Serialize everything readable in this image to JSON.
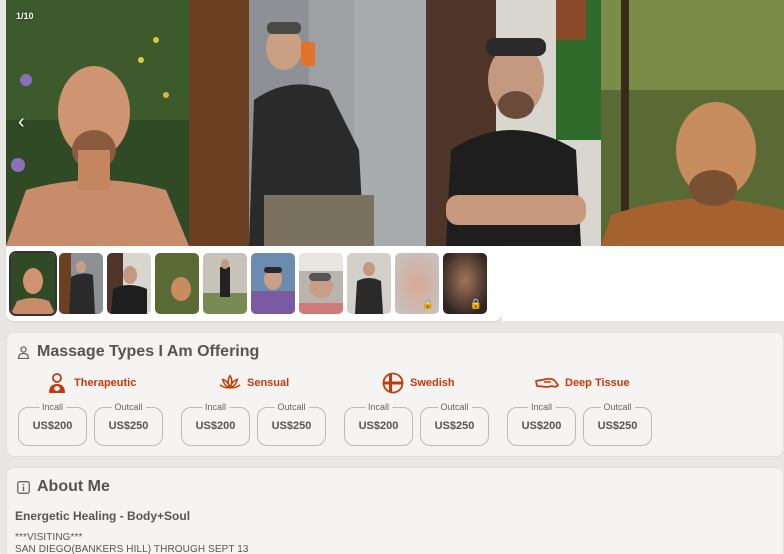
{
  "gallery": {
    "counter": "1/10",
    "prev_arrow": "‹",
    "thumb_count": 10,
    "locked_thumbs": [
      8,
      9
    ]
  },
  "massage": {
    "title": "Massage Types I Am Offering",
    "types": [
      {
        "name": "Therapeutic",
        "icon": "therapist-icon",
        "incall_label": "Incall",
        "incall": "US$200",
        "outcall_label": "Outcall",
        "outcall": "US$250"
      },
      {
        "name": "Sensual",
        "icon": "lotus-icon",
        "incall_label": "Incall",
        "incall": "US$200",
        "outcall_label": "Outcall",
        "outcall": "US$250"
      },
      {
        "name": "Swedish",
        "icon": "swedish-icon",
        "incall_label": "Incall",
        "incall": "US$200",
        "outcall_label": "Outcall",
        "outcall": "US$250"
      },
      {
        "name": "Deep Tissue",
        "icon": "deep-tissue-icon",
        "incall_label": "Incall",
        "incall": "US$200",
        "outcall_label": "Outcall",
        "outcall": "US$250"
      }
    ]
  },
  "about": {
    "title": "About Me",
    "subtitle": "Energetic Healing - Body+Soul",
    "line1": "***VISITING***",
    "line2": "SAN DIEGO(BANKERS HILL) THROUGH SEPT 13"
  },
  "colors": {
    "accent": "#c8390a"
  }
}
